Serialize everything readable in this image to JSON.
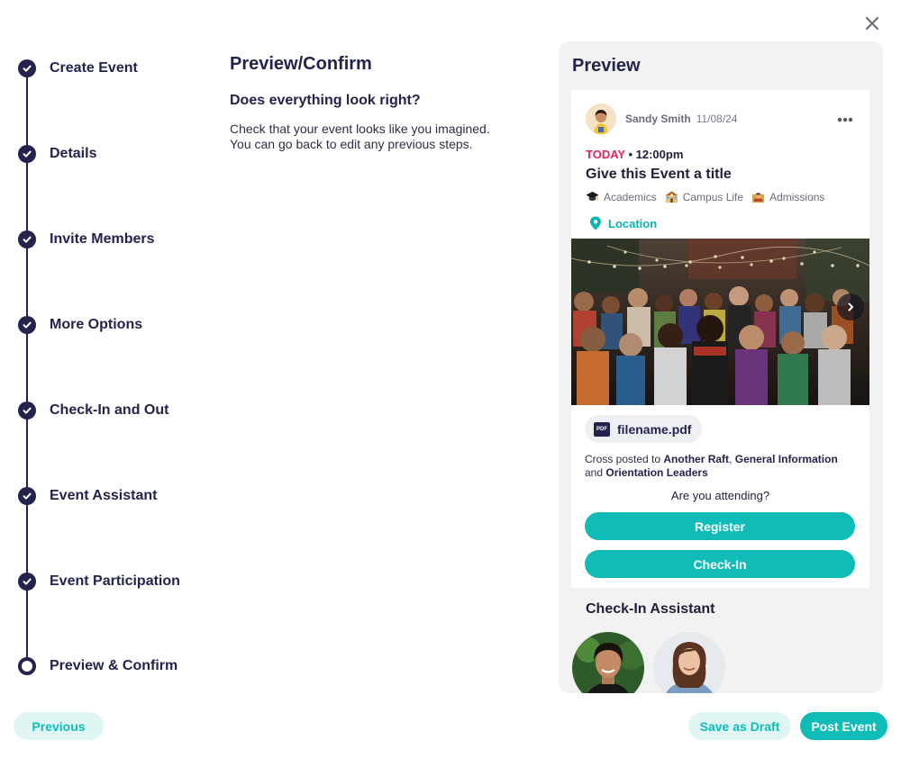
{
  "stepper": {
    "steps": [
      {
        "label": "Create Event",
        "state": "complete"
      },
      {
        "label": "Details",
        "state": "complete"
      },
      {
        "label": "Invite Members",
        "state": "complete"
      },
      {
        "label": "More Options",
        "state": "complete"
      },
      {
        "label": "Check-In and Out",
        "state": "complete"
      },
      {
        "label": "Event Assistant",
        "state": "complete"
      },
      {
        "label": "Event Participation",
        "state": "complete"
      },
      {
        "label": "Preview & Confirm",
        "state": "current"
      }
    ]
  },
  "main": {
    "title": "Preview/Confirm",
    "question": "Does everything look right?",
    "description": "Check that your event looks like you imagined.\nYou can go back to edit any previous steps."
  },
  "preview": {
    "title": "Preview",
    "card": {
      "author": "Sandy Smith",
      "post_date": "11/08/24",
      "day": "TODAY",
      "time": "• 12:00pm",
      "event_title": "Give this Event a title",
      "tags": [
        "Academics",
        "Campus Life",
        "Admissions"
      ],
      "location_label": "Location",
      "file_name": "filename.pdf",
      "file_badge": "PDF",
      "crosspost": {
        "prefix": "Cross posted to",
        "group1": "Another Raft",
        "separator": ",",
        "group2": "General Information",
        "conjunction": "and",
        "group3": "Orientation Leaders"
      },
      "attending_question": "Are you attending?",
      "register_label": "Register",
      "checkin_label": "Check-In"
    },
    "checkin_assistant_title": "Check-In Assistant"
  },
  "footer": {
    "previous_label": "Previous",
    "save_draft_label": "Save as Draft",
    "post_label": "Post Event"
  },
  "colors": {
    "navy": "#23234d",
    "teal": "#0fbcb8",
    "teal_light": "#dff6f5",
    "today_red": "#e0245e",
    "panel_bg": "#f2f2f2"
  },
  "icons": [
    "close-icon",
    "check-icon",
    "more-icon",
    "graduation-cap-icon",
    "school-building-icon",
    "admissions-icon",
    "location-pin-icon",
    "chevron-right-icon",
    "pdf-icon"
  ]
}
